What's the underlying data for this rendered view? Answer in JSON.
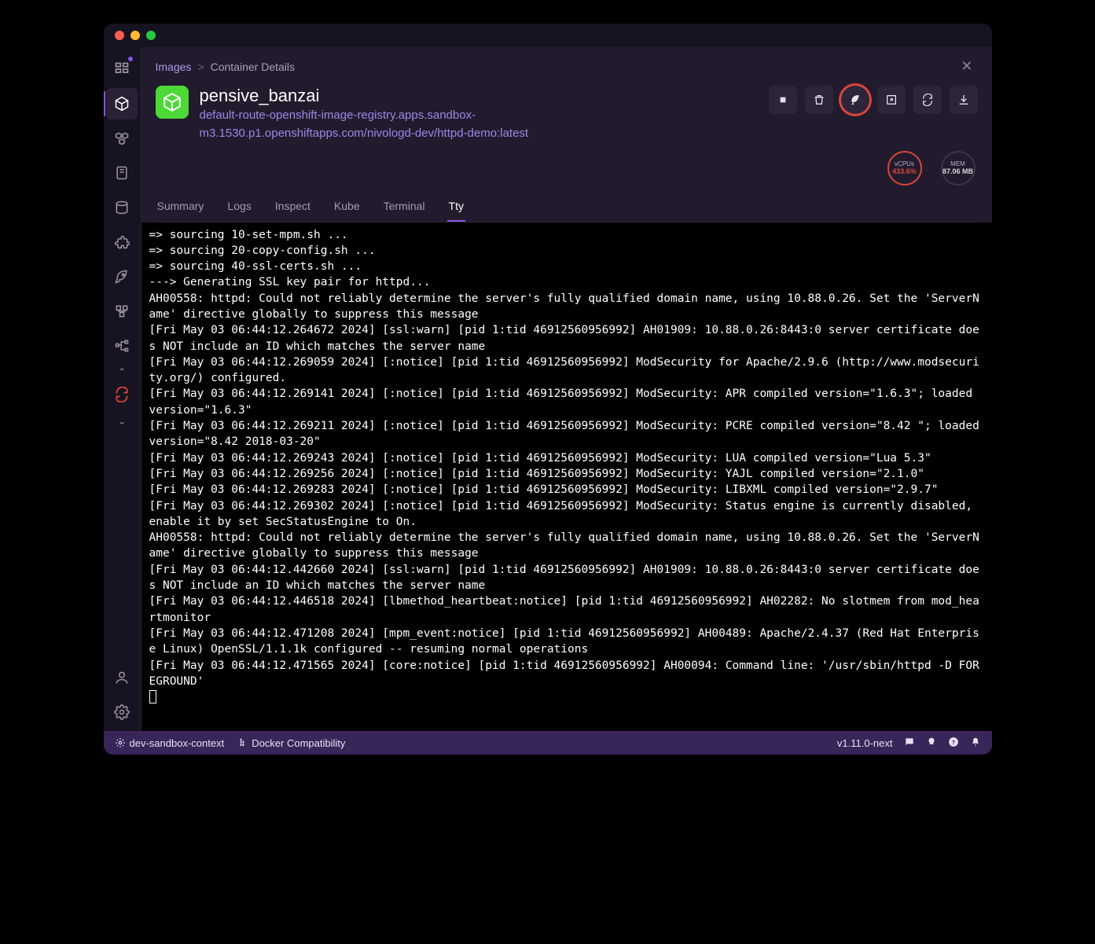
{
  "breadcrumb": {
    "root": "Images",
    "current": "Container Details"
  },
  "container": {
    "name": "pensive_banzai",
    "image": "default-route-openshift-image-registry.apps.sandbox-m3.1530.p1.openshiftapps.com/nivologd-dev/httpd-demo:latest"
  },
  "stats": {
    "vcpu_label": "vCPUs",
    "vcpu_value": "433.6%",
    "mem_label": "MEM",
    "mem_value": "87.06 MB"
  },
  "tabs": {
    "summary": "Summary",
    "logs": "Logs",
    "inspect": "Inspect",
    "kube": "Kube",
    "terminal": "Terminal",
    "tty": "Tty"
  },
  "tty_lines": [
    "=> sourcing 10-set-mpm.sh ...",
    "=> sourcing 20-copy-config.sh ...",
    "=> sourcing 40-ssl-certs.sh ...",
    "---> Generating SSL key pair for httpd...",
    "AH00558: httpd: Could not reliably determine the server's fully qualified domain name, using 10.88.0.26. Set the 'ServerName' directive globally to suppress this message",
    "[Fri May 03 06:44:12.264672 2024] [ssl:warn] [pid 1:tid 46912560956992] AH01909: 10.88.0.26:8443:0 server certificate does NOT include an ID which matches the server name",
    "[Fri May 03 06:44:12.269059 2024] [:notice] [pid 1:tid 46912560956992] ModSecurity for Apache/2.9.6 (http://www.modsecurity.org/) configured.",
    "[Fri May 03 06:44:12.269141 2024] [:notice] [pid 1:tid 46912560956992] ModSecurity: APR compiled version=\"1.6.3\"; loaded version=\"1.6.3\"",
    "[Fri May 03 06:44:12.269211 2024] [:notice] [pid 1:tid 46912560956992] ModSecurity: PCRE compiled version=\"8.42 \"; loaded version=\"8.42 2018-03-20\"",
    "[Fri May 03 06:44:12.269243 2024] [:notice] [pid 1:tid 46912560956992] ModSecurity: LUA compiled version=\"Lua 5.3\"",
    "[Fri May 03 06:44:12.269256 2024] [:notice] [pid 1:tid 46912560956992] ModSecurity: YAJL compiled version=\"2.1.0\"",
    "[Fri May 03 06:44:12.269283 2024] [:notice] [pid 1:tid 46912560956992] ModSecurity: LIBXML compiled version=\"2.9.7\"",
    "[Fri May 03 06:44:12.269302 2024] [:notice] [pid 1:tid 46912560956992] ModSecurity: Status engine is currently disabled, enable it by set SecStatusEngine to On.",
    "AH00558: httpd: Could not reliably determine the server's fully qualified domain name, using 10.88.0.26. Set the 'ServerName' directive globally to suppress this message",
    "[Fri May 03 06:44:12.442660 2024] [ssl:warn] [pid 1:tid 46912560956992] AH01909: 10.88.0.26:8443:0 server certificate does NOT include an ID which matches the server name",
    "[Fri May 03 06:44:12.446518 2024] [lbmethod_heartbeat:notice] [pid 1:tid 46912560956992] AH02282: No slotmem from mod_heartmonitor",
    "[Fri May 03 06:44:12.471208 2024] [mpm_event:notice] [pid 1:tid 46912560956992] AH00489: Apache/2.4.37 (Red Hat Enterprise Linux) OpenSSL/1.1.1k configured -- resuming normal operations",
    "[Fri May 03 06:44:12.471565 2024] [core:notice] [pid 1:tid 46912560956992] AH00094: Command line: '/usr/sbin/httpd -D FOREGROUND'"
  ],
  "statusbar": {
    "context": "dev-sandbox-context",
    "docker": "Docker Compatibility",
    "version": "v1.11.0-next"
  }
}
